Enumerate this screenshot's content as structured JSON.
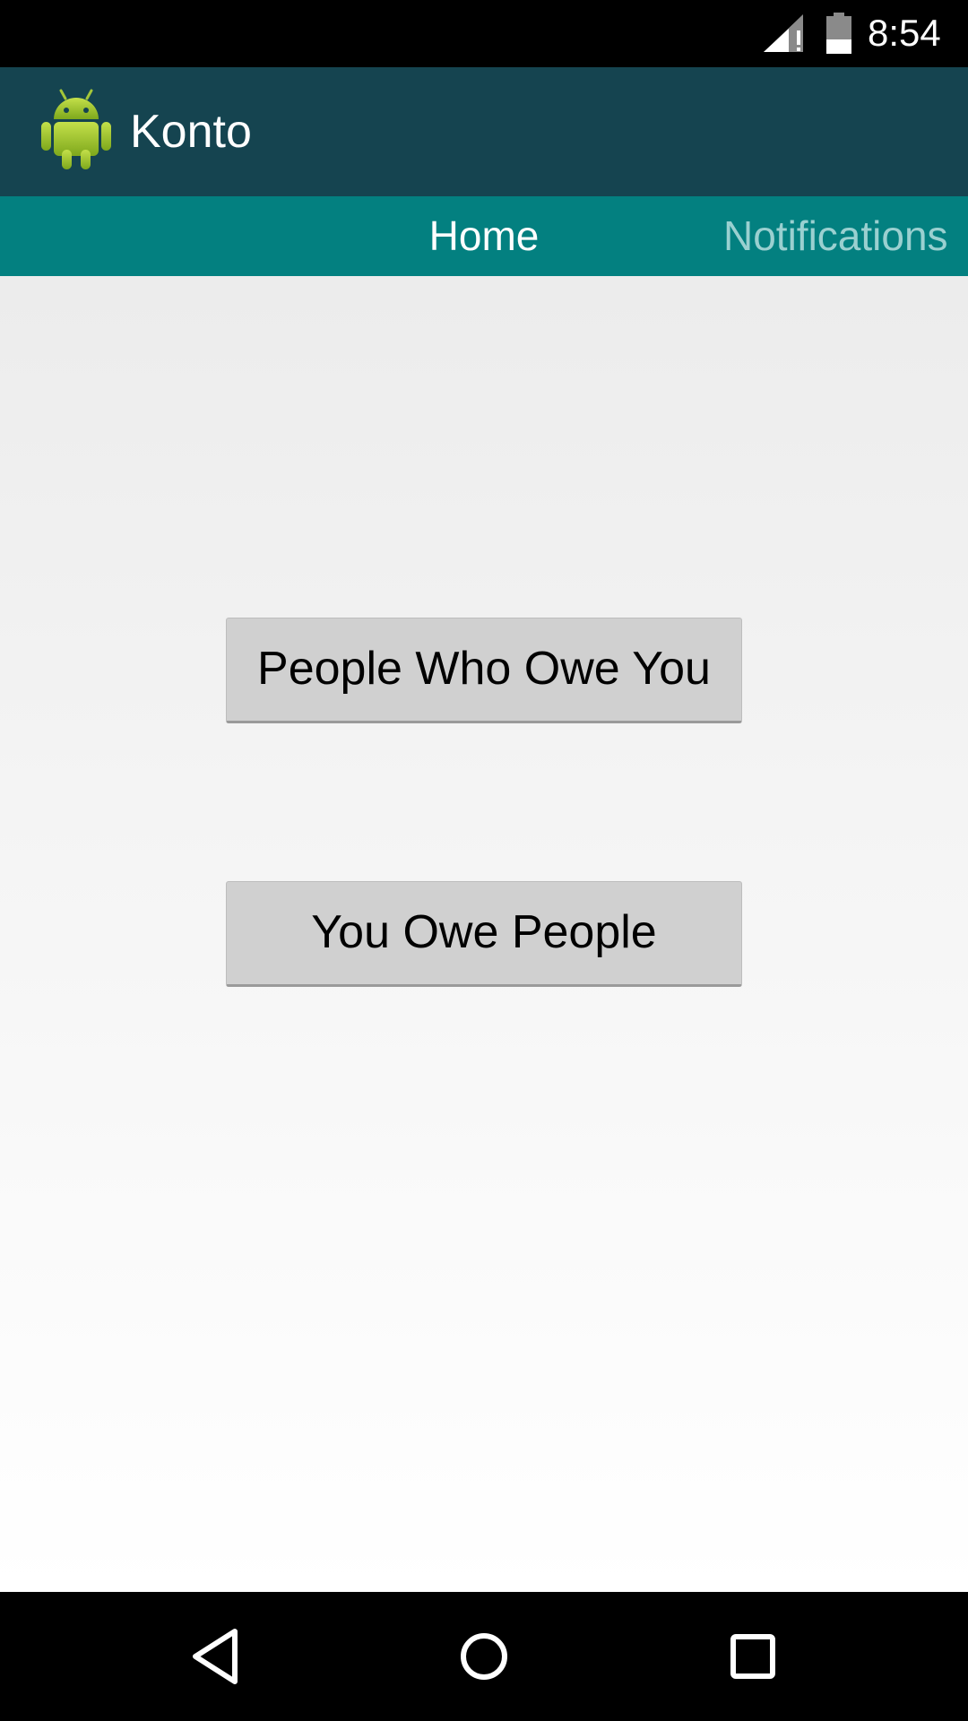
{
  "status_bar": {
    "time": "8:54",
    "icons": [
      "signal-no-data-icon",
      "battery-icon"
    ]
  },
  "action_bar": {
    "app_icon": "android-robot-icon",
    "title": "Konto",
    "background": "#154450"
  },
  "tabs": {
    "background": "#038080",
    "items": [
      {
        "label": "Home",
        "selected": true
      },
      {
        "label": "Notifications",
        "selected": false
      }
    ]
  },
  "main": {
    "buttons": [
      {
        "label": "People Who Owe You"
      },
      {
        "label": "You Owe People"
      }
    ]
  },
  "nav_bar": {
    "icons": [
      "back-icon",
      "home-icon",
      "recents-icon"
    ]
  }
}
